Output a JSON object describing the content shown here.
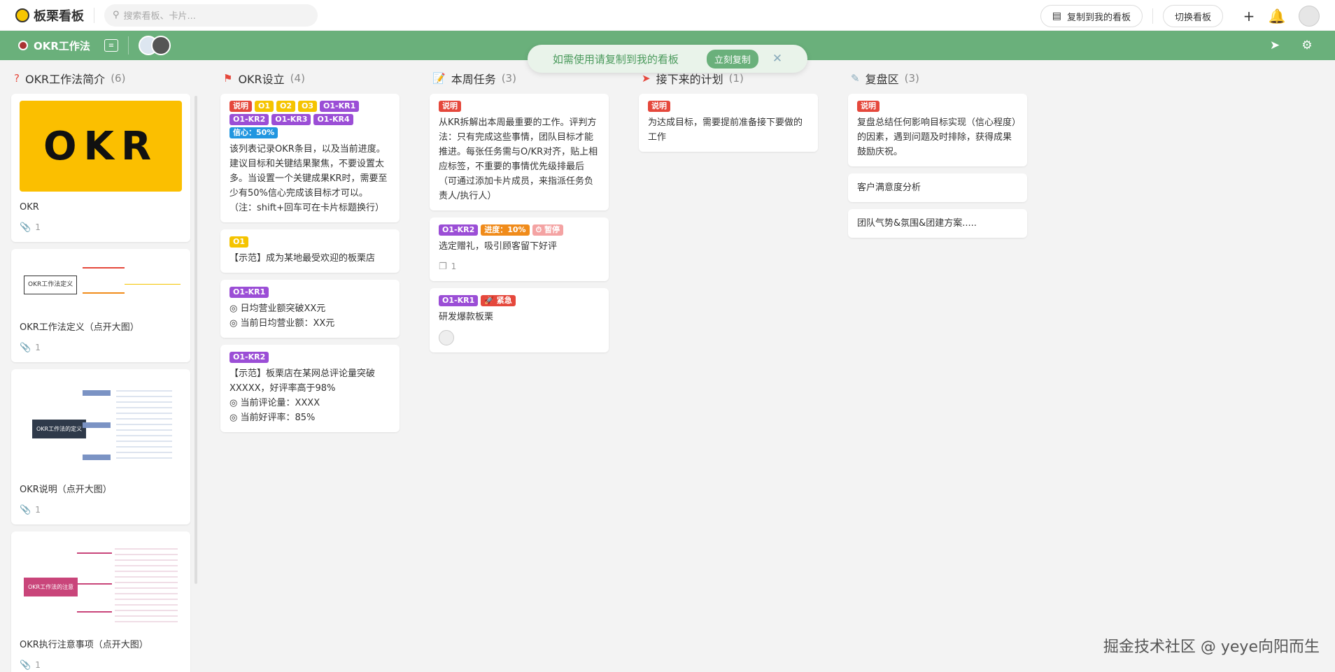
{
  "app": {
    "title": "板栗看板"
  },
  "search": {
    "placeholder": "搜索看板、卡片..."
  },
  "topbar": {
    "copy_button": "复制到我的看板",
    "switch_button": "切换看板"
  },
  "board": {
    "name": "OKR工作法"
  },
  "toast": {
    "message": "如需使用请复制到我的看板",
    "action": "立刻复制"
  },
  "columns": [
    {
      "title": "OKR工作法简介",
      "count": "(6)",
      "icon": "question-icon"
    },
    {
      "title": "OKR设立",
      "count": "(4)",
      "icon": "flag-icon"
    },
    {
      "title": "本周任务",
      "count": "(3)",
      "icon": "memo-icon"
    },
    {
      "title": "接下来的计划",
      "count": "(1)",
      "icon": "rocket-icon"
    },
    {
      "title": "复盘区",
      "count": "(3)",
      "icon": "broom-icon"
    }
  ],
  "col1": {
    "cards": [
      {
        "image_text": "OKR",
        "title": "OKR",
        "attachments": "1"
      },
      {
        "image_text": "OKR工作法定义",
        "title": "OKR工作法定义（点开大图）",
        "attachments": "1"
      },
      {
        "image_text": "OKR工作法的定义",
        "title": "OKR说明（点开大图）",
        "attachments": "1"
      },
      {
        "image_text": "OKR工作法的注意",
        "title": "OKR执行注意事项（点开大图）",
        "attachments": "1"
      }
    ]
  },
  "col2": {
    "card1": {
      "tags": [
        "说明",
        "O1",
        "O2",
        "O3",
        "O1-KR1",
        "O1-KR2",
        "O1-KR3",
        "O1-KR4",
        "信心：50%"
      ],
      "body": "该列表记录OKR条目，以及当前进度。建议目标和关键结果聚焦，不要设置太多。当设置一个关键成果KR时，需要至少有50%信心完成该目标才可以。（注：shift+回车可在卡片标题换行）"
    },
    "card2": {
      "tag": "O1",
      "body": "【示范】成为某地最受欢迎的板栗店"
    },
    "card3": {
      "tag": "O1-KR1",
      "line1": "◎ 日均营业额突破XX元",
      "line2": "◎ 当前日均营业额：XX元"
    },
    "card4": {
      "tag": "O1-KR2",
      "line1": "【示范】板栗店在某网总评论量突破XXXXX，好评率高于98%",
      "line2": "◎ 当前评论量：XXXX",
      "line3": "◎ 当前好评率：85%"
    }
  },
  "col3": {
    "card1": {
      "tag": "说明",
      "body": "从KR拆解出本周最重要的工作。评判方法：只有完成这些事情，团队目标才能推进。每张任务需与O/KR对齐，贴上相应标签，不重要的事情优先级排最后（可通过添加卡片成员，来指派任务负责人/执行人）"
    },
    "card2": {
      "tags": [
        "O1-KR2",
        "进度：10%",
        "⏱ 暂停"
      ],
      "body": "选定赠礼，吸引顾客留下好评",
      "checklist": "1"
    },
    "card3": {
      "tags": [
        "O1-KR1",
        "🚀 紧急"
      ],
      "body": "研发爆款板栗"
    }
  },
  "col4": {
    "card1": {
      "tag": "说明",
      "body": "为达成目标，需要提前准备接下要做的工作"
    }
  },
  "col5": {
    "card1": {
      "tag": "说明",
      "body": "复盘总结任何影响目标实现（信心程度）的因素，遇到问题及时排除，获得成果鼓励庆祝。"
    },
    "card2": {
      "body": "客户满意度分析"
    },
    "card3": {
      "body": "团队气势&氛围&团建方案....."
    }
  },
  "watermark": "掘金技术社区 @ yeye向阳而生",
  "colors": {
    "green": "#6ab07b",
    "red": "#e5483c",
    "yellow": "#f5c400",
    "purple": "#9b4ed6",
    "blue": "#2196e0",
    "orange": "#f08b1a"
  }
}
